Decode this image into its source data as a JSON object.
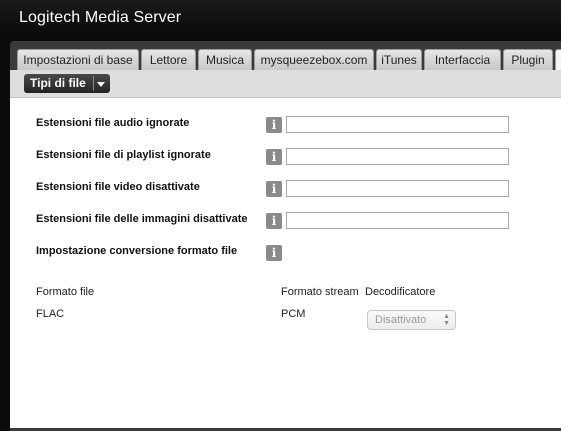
{
  "app": {
    "title_brand": "Logitech",
    "title_rest": "Media Server"
  },
  "tabs": [
    {
      "label": "Impostazioni di base"
    },
    {
      "label": "Lettore"
    },
    {
      "label": "Musica"
    },
    {
      "label": "mysqueezebox.com"
    },
    {
      "label": "iTunes"
    },
    {
      "label": "Interfaccia"
    },
    {
      "label": "Plugin"
    }
  ],
  "subnav": {
    "selected": "Tipi di file"
  },
  "settings": [
    {
      "label": "Estensioni file audio ignorate",
      "value": ""
    },
    {
      "label": "Estensioni file di playlist ignorate",
      "value": ""
    },
    {
      "label": "Estensioni file video disattivate",
      "value": ""
    },
    {
      "label": "Estensioni file delle immagini disattivate",
      "value": ""
    },
    {
      "label": "Impostazione conversione formato file"
    }
  ],
  "table": {
    "headers": [
      "Formato file",
      "Formato stream",
      "Decodificatore"
    ],
    "rows": [
      {
        "format": "FLAC",
        "stream": "PCM",
        "decoder": "Disattivato"
      }
    ]
  },
  "icons": {
    "info": "info-icon",
    "dropdown": "chevron-down-icon",
    "select": "updown-chevron-icon"
  }
}
